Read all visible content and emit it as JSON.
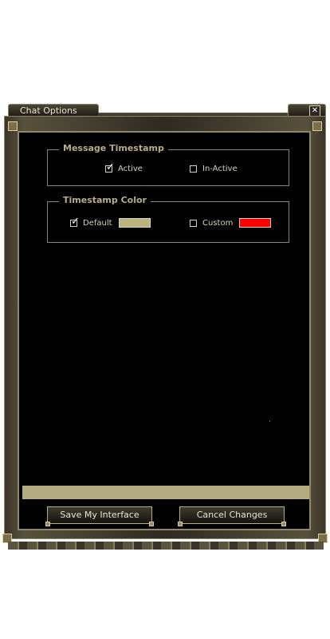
{
  "window": {
    "title": "Chat Options",
    "close_glyph": "✕"
  },
  "message_timestamp": {
    "legend": "Message Timestamp",
    "active_label": "Active",
    "active_checked": true,
    "inactive_label": "In-Active",
    "inactive_checked": false
  },
  "timestamp_color": {
    "legend": "Timestamp Color",
    "default_label": "Default",
    "default_checked": true,
    "default_color": "#bab27f",
    "custom_label": "Custom",
    "custom_checked": false,
    "custom_color": "#ff0000"
  },
  "buttons": {
    "save_label": "Save My Interface",
    "cancel_label": "Cancel Changes"
  },
  "colors": {
    "frame": "#57513d",
    "panel": "#000000",
    "accent_text": "#b6ad8a",
    "bar": "#b5aa80"
  }
}
